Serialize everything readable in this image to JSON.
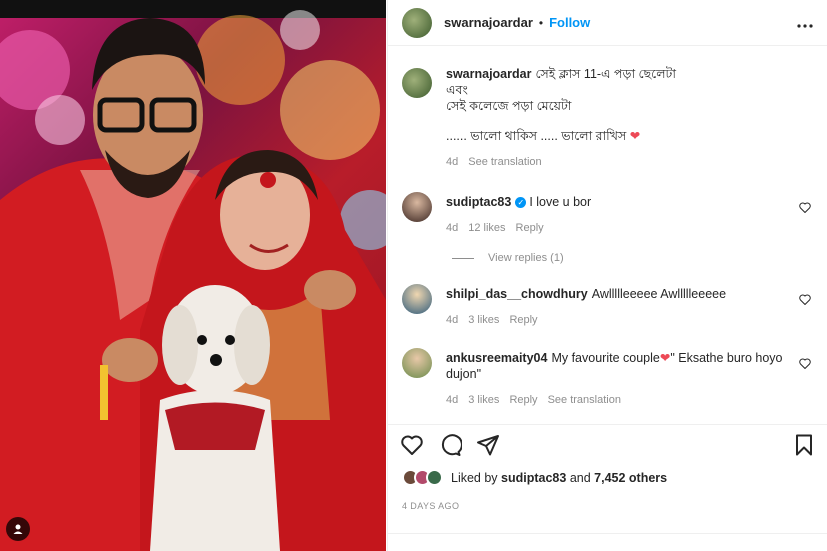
{
  "post": {
    "author": "swarnajoardar",
    "separator": "•",
    "follow_label": "Follow",
    "more_label": "•••",
    "caption_lines": [
      "সেই ক্লাস 11-এ পড়া ছেলেটা",
      "এবং",
      "সেই কলেজে পড়া মেয়েটা"
    ],
    "caption_last": "...... ভালো থাকিস ..... ভালো রাখিস",
    "caption_heart": "❤",
    "caption_time": "4d",
    "see_translation": "See translation"
  },
  "comments": [
    {
      "user": "sudiptac83",
      "verified": true,
      "text": "I love u bor",
      "time": "4d",
      "likes": "12 likes",
      "reply": "Reply",
      "view_replies": "View replies (1)"
    },
    {
      "user": "shilpi_das__chowdhury",
      "text": "Awllllleeeee Awllllleeeee",
      "time": "4d",
      "likes": "3 likes",
      "reply": "Reply"
    },
    {
      "user": "ankusreemaity04",
      "text": "My favourite couple",
      "text_heart": "❤",
      "text_after": "\" Eksathe buro hoyo dujon\"",
      "time": "4d",
      "likes": "3 likes",
      "reply": "Reply",
      "see_translation": "See translation"
    }
  ],
  "likes": {
    "prefix": "Liked by ",
    "user": "sudiptac83",
    "middle": " and ",
    "count": "7,452 others"
  },
  "posted_ago": "4 DAYS AGO",
  "icons": [
    "heart-icon",
    "comment-icon",
    "share-icon",
    "bookmark-icon",
    "more-icon",
    "user-tag-icon"
  ],
  "colors": {
    "accent": "#0095f6",
    "heart": "#ed4956",
    "muted": "#8e8e8e"
  }
}
